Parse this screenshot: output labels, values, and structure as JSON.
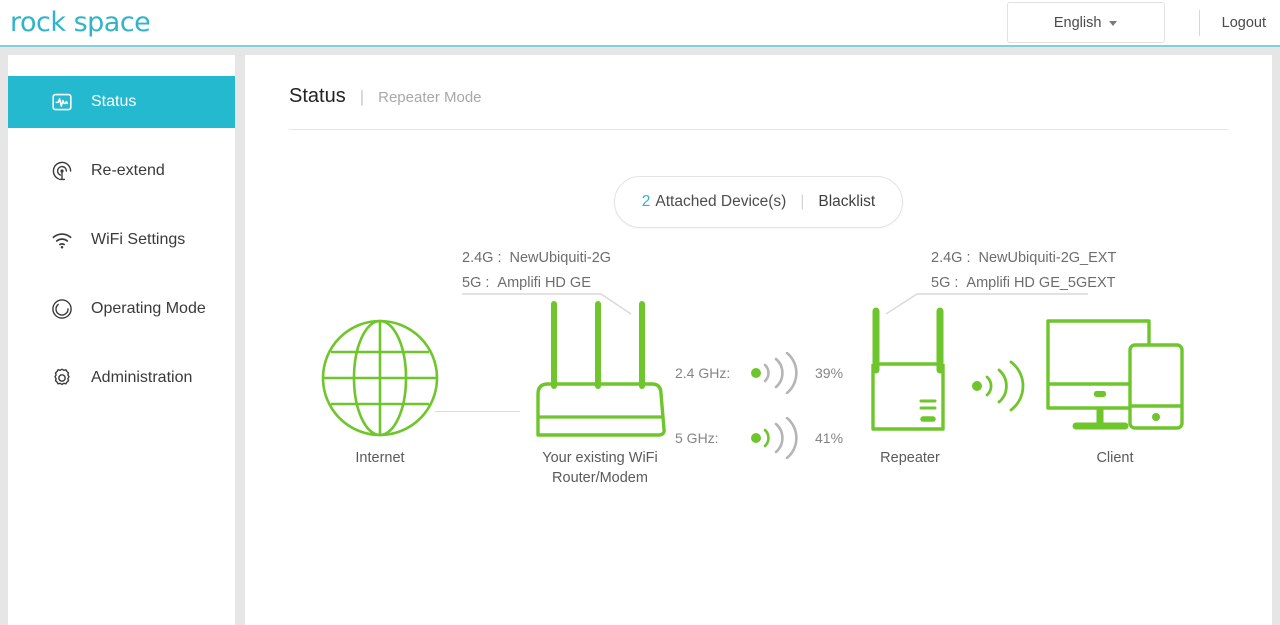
{
  "header": {
    "brand": "rock space",
    "language": "English",
    "logout": "Logout",
    "caret_icon": "chevron-down-icon"
  },
  "sidebar": {
    "items": [
      {
        "label": "Status",
        "icon": "status-monitor-icon",
        "active": true
      },
      {
        "label": "Re-extend",
        "icon": "signal-broadcast-icon",
        "active": false
      },
      {
        "label": "WiFi Settings",
        "icon": "wifi-icon",
        "active": false
      },
      {
        "label": "Operating Mode",
        "icon": "circle-mode-icon",
        "active": false
      },
      {
        "label": "Administration",
        "icon": "gear-icon",
        "active": false
      }
    ]
  },
  "page": {
    "title": "Status",
    "separator": "|",
    "subtitle": "Repeater Mode"
  },
  "attached": {
    "count": "2",
    "label": "Attached Device(s)",
    "separator": "|",
    "blacklist": "Blacklist"
  },
  "diagram": {
    "router_ssid": {
      "band24_key": "2.4G :",
      "band24_value": "NewUbiquiti-2G",
      "band5_key": "5G :",
      "band5_value": "Amplifi HD GE"
    },
    "repeater_ssid": {
      "band24_key": "2.4G :",
      "band24_value": "NewUbiquiti-2G_EXT",
      "band5_key": "5G :",
      "band5_value": "Amplifi HD GE_5GEXT"
    },
    "signals": [
      {
        "name": "2.4 GHz:",
        "percent": "39%",
        "lit_arcs": 0
      },
      {
        "name": "5 GHz:",
        "percent": "41%",
        "lit_arcs": 1
      }
    ],
    "client_link_lit_arcs": 3,
    "nodes": [
      {
        "label": "Internet",
        "icon": "globe-icon"
      },
      {
        "label": "Your existing WiFi\nRouter/Modem",
        "icon": "router-icon"
      },
      {
        "label": "Repeater",
        "icon": "repeater-icon"
      },
      {
        "label": "Client",
        "icon": "client-devices-icon"
      }
    ]
  },
  "colors": {
    "accent": "#25b9d0",
    "green": "#6fc62c",
    "gray_arc": "#b5b5b5",
    "text": "#5a5a5a"
  }
}
